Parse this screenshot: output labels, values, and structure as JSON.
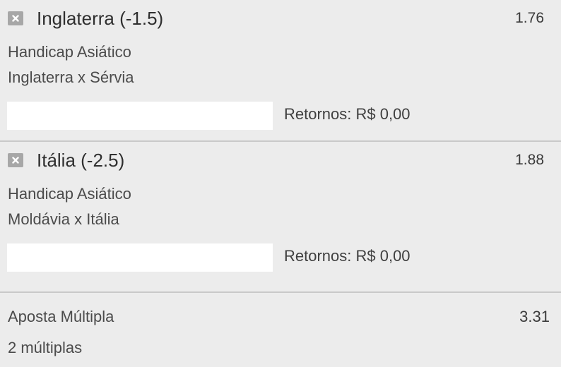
{
  "bets": [
    {
      "selection": "Inglaterra (-1.5)",
      "odds": "1.76",
      "market": "Handicap Asiático",
      "match": "Inglaterra x Sérvia",
      "stake_value": "",
      "returns": "Retornos: R$ 0,00"
    },
    {
      "selection": "Itália (-2.5)",
      "odds": "1.88",
      "market": "Handicap Asiático",
      "match": "Moldávia x Itália",
      "stake_value": "",
      "returns": "Retornos: R$ 0,00"
    }
  ],
  "multiple": {
    "label": "Aposta Múltipla",
    "odds": "3.31",
    "count": "2 múltiplas"
  },
  "icons": {
    "remove": "close-icon"
  },
  "colors": {
    "background": "#ececec",
    "divider": "#c9c9c9",
    "close_button": "#a7a7a7",
    "input_background": "#ffffff"
  }
}
